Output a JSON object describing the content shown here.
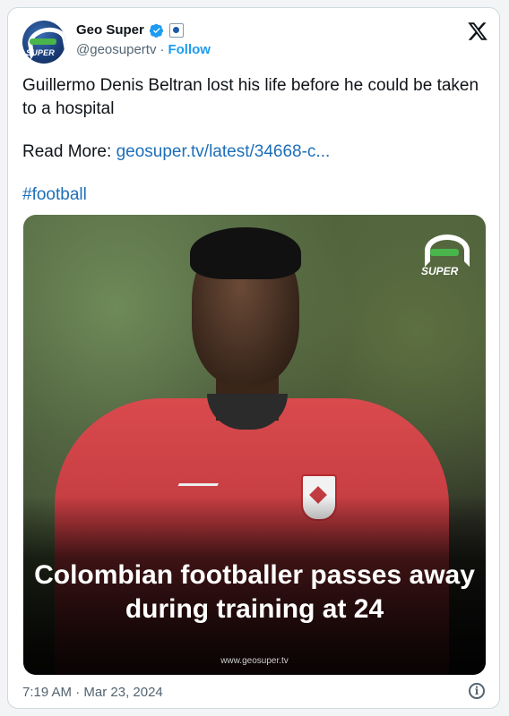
{
  "header": {
    "name": "Geo Super",
    "handle": "@geosupertv",
    "separator": "·",
    "follow_label": "Follow",
    "avatar_text": "SUPER"
  },
  "tweet": {
    "text": "Guillermo Denis Beltran lost his life before he could be taken to a hospital",
    "read_more_label": "Read More:",
    "link_text": "geosuper.tv/latest/34668-c...",
    "hashtag": "#football"
  },
  "media": {
    "headline": "Colombian footballer passes away during training at 24",
    "logo_text": "SUPER",
    "site_text": "www.geosuper.tv"
  },
  "meta": {
    "time": "7:19 AM",
    "separator": "·",
    "date": "Mar 23, 2024"
  },
  "colors": {
    "accent": "#1d9bf0",
    "link": "#1d6fb8",
    "secondary_text": "#536471"
  },
  "icons": [
    "verified-badge-icon",
    "affiliate-badge-icon",
    "x-logo-icon",
    "info-icon"
  ]
}
